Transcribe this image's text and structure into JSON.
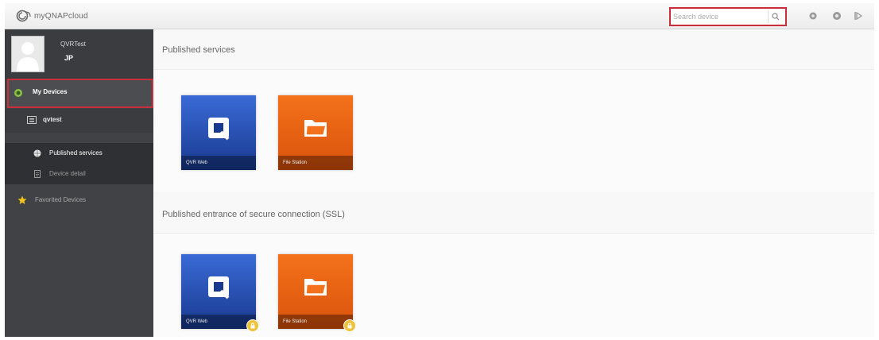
{
  "app": {
    "logo_text": "myQNAPcloud"
  },
  "header": {
    "search": {
      "placeholder": "Search device",
      "value": ""
    },
    "icons": [
      "settings-icon",
      "help-icon",
      "logout-icon"
    ]
  },
  "sidebar": {
    "user": {
      "name": "QVRTest",
      "sub": "JP"
    },
    "my_devices_label": "My Devices",
    "device_label": "qvtest",
    "sub_items": [
      {
        "label": "Published services",
        "active": true
      },
      {
        "label": "Device detail",
        "active": false
      }
    ],
    "favorites_label": "Favorited Devices"
  },
  "main": {
    "sections": [
      {
        "title": "Published services",
        "tiles": [
          {
            "label": "QVR Web",
            "color": "blue",
            "locked": false
          },
          {
            "label": "File Station",
            "color": "orange",
            "locked": false
          }
        ]
      },
      {
        "title": "Published entrance of secure connection (SSL)",
        "tiles": [
          {
            "label": "QVR Web",
            "color": "blue",
            "locked": true
          },
          {
            "label": "File Station",
            "color": "orange",
            "locked": true
          }
        ]
      }
    ]
  },
  "colors": {
    "highlight": "#c92f3a",
    "sidebar": "#404245",
    "tile_blue": "#2a55c0",
    "tile_orange": "#ee6512"
  }
}
